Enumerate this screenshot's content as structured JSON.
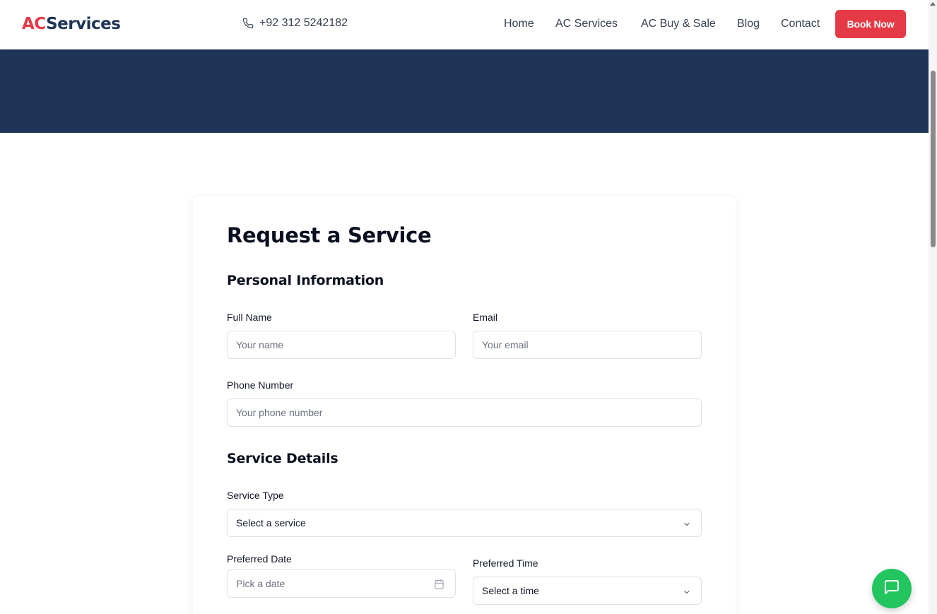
{
  "brand": {
    "logo_prefix": "AC",
    "logo_suffix": "Services",
    "accent": "#e63946",
    "navy": "#1e3557",
    "chat_color": "#22c55e"
  },
  "header": {
    "phone": "+92 312 5242182",
    "nav": [
      "Home",
      "AC Services",
      "AC Buy & Sale",
      "Blog",
      "Contact"
    ],
    "cta": "Book Now"
  },
  "form": {
    "title": "Request a Service",
    "personal": {
      "heading": "Personal Information",
      "full_name": {
        "label": "Full Name",
        "placeholder": "Your name"
      },
      "email": {
        "label": "Email",
        "placeholder": "Your email"
      },
      "phone": {
        "label": "Phone Number",
        "placeholder": "Your phone number"
      }
    },
    "service": {
      "heading": "Service Details",
      "type": {
        "label": "Service Type",
        "value": "Select a service"
      },
      "date": {
        "label": "Preferred Date",
        "placeholder": "Pick a date"
      },
      "time": {
        "label": "Preferred Time",
        "value": "Select a time"
      }
    }
  }
}
